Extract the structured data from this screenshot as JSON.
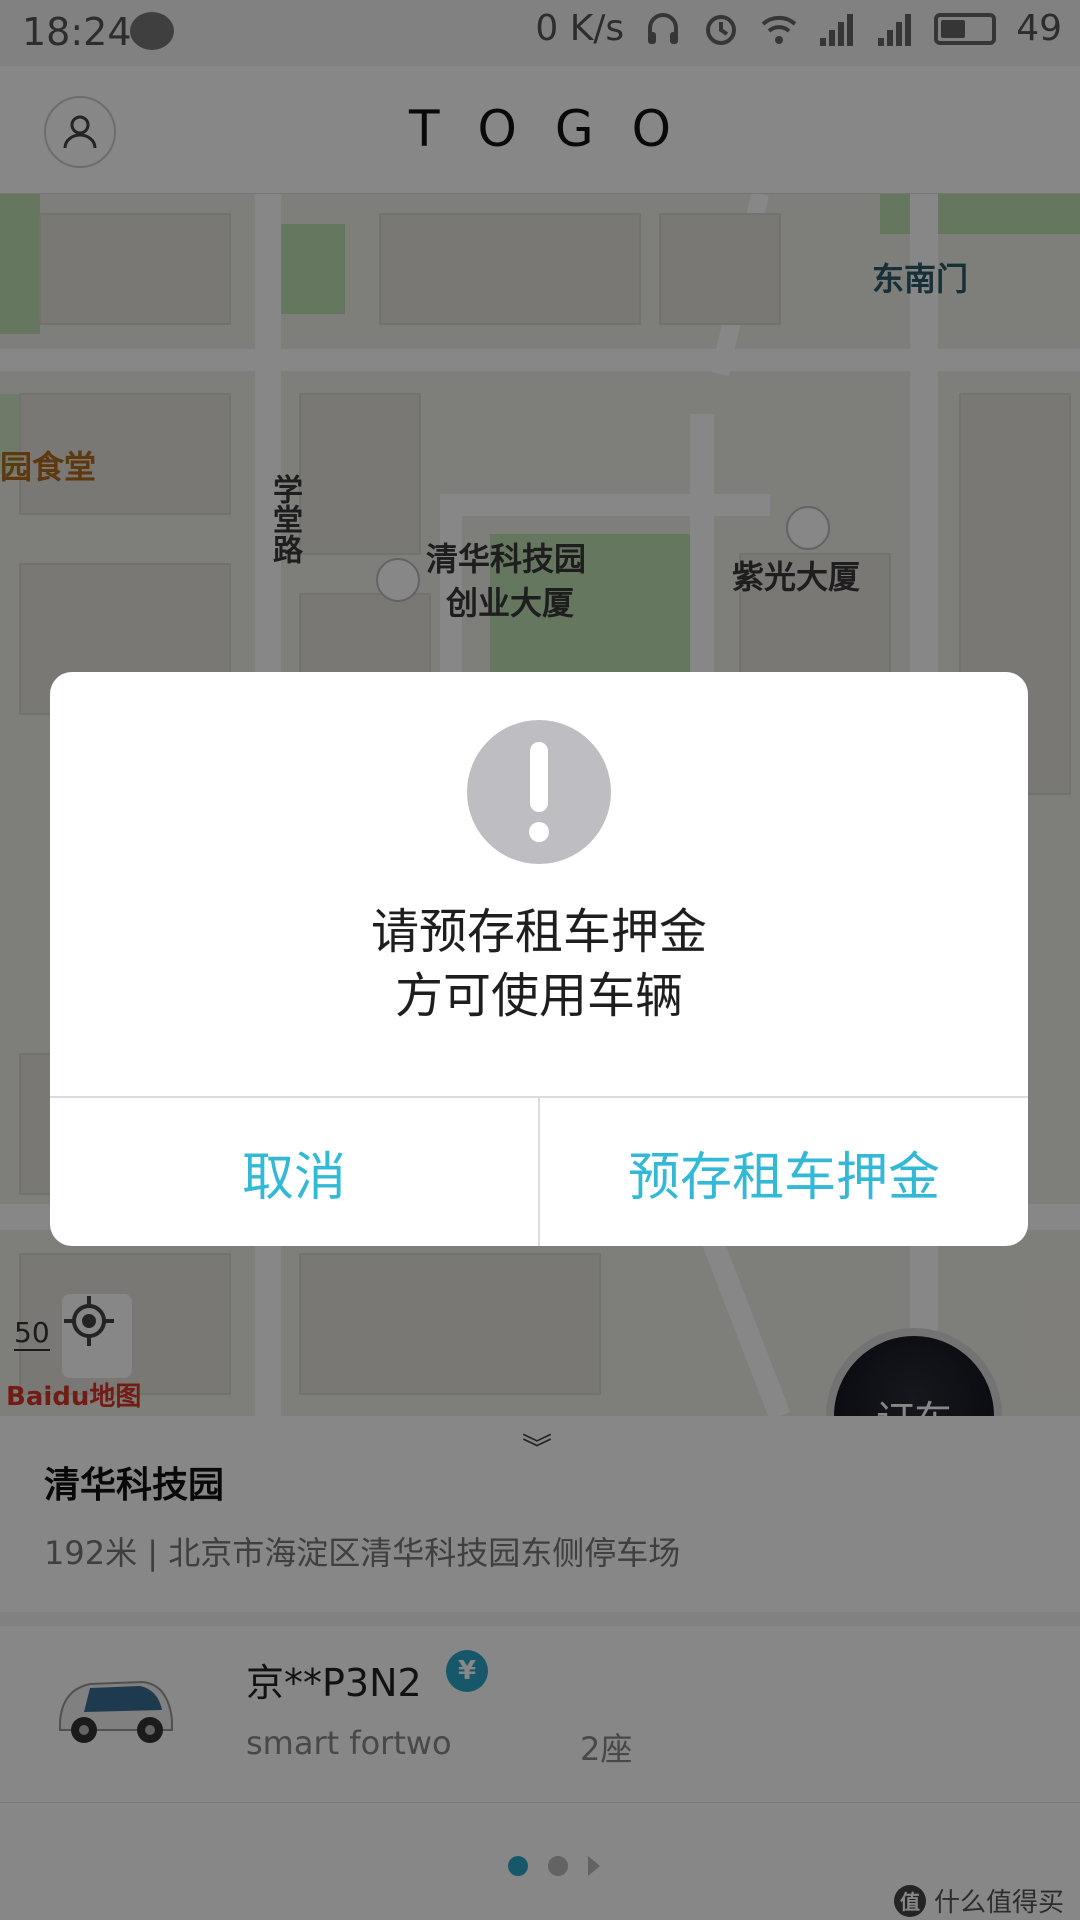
{
  "status_bar": {
    "time": "18:24",
    "speed": "0 K/s",
    "battery": "49"
  },
  "app_bar": {
    "brand": "TOGO"
  },
  "map": {
    "labels": {
      "southeast_gate": "东南门",
      "canteen": "园食堂",
      "xuetang_road": "学堂路",
      "tsinghua_park_line1": "清华科技园",
      "tsinghua_park_line2": "创业大厦",
      "ziguang": "紫光大厦"
    },
    "scale": "50",
    "baidu": "Baidu地图"
  },
  "order_button": {
    "label": "订车"
  },
  "panel": {
    "location_name": "清华科技园",
    "location_address": "192米 | 北京市海淀区清华科技园东侧停车场",
    "car": {
      "plate": "京**P3N2",
      "model": "smart fortwo",
      "seats": "2座",
      "badge": "¥"
    }
  },
  "watermark": {
    "text": "什么值得买",
    "logo": "值"
  },
  "dialog": {
    "message_line1": "请预存租车押金",
    "message_line2": "方可使用车辆",
    "cancel_label": "取消",
    "confirm_label": "预存租车押金"
  },
  "colors": {
    "accent": "#33b8d6",
    "badge": "#2aa6c7",
    "alert_icon": "#bdbdc2"
  },
  "icons": {
    "profile": "person-icon",
    "locate": "crosshair-icon",
    "collapse": "chevron-double-down-icon",
    "alert": "exclamation-icon"
  }
}
